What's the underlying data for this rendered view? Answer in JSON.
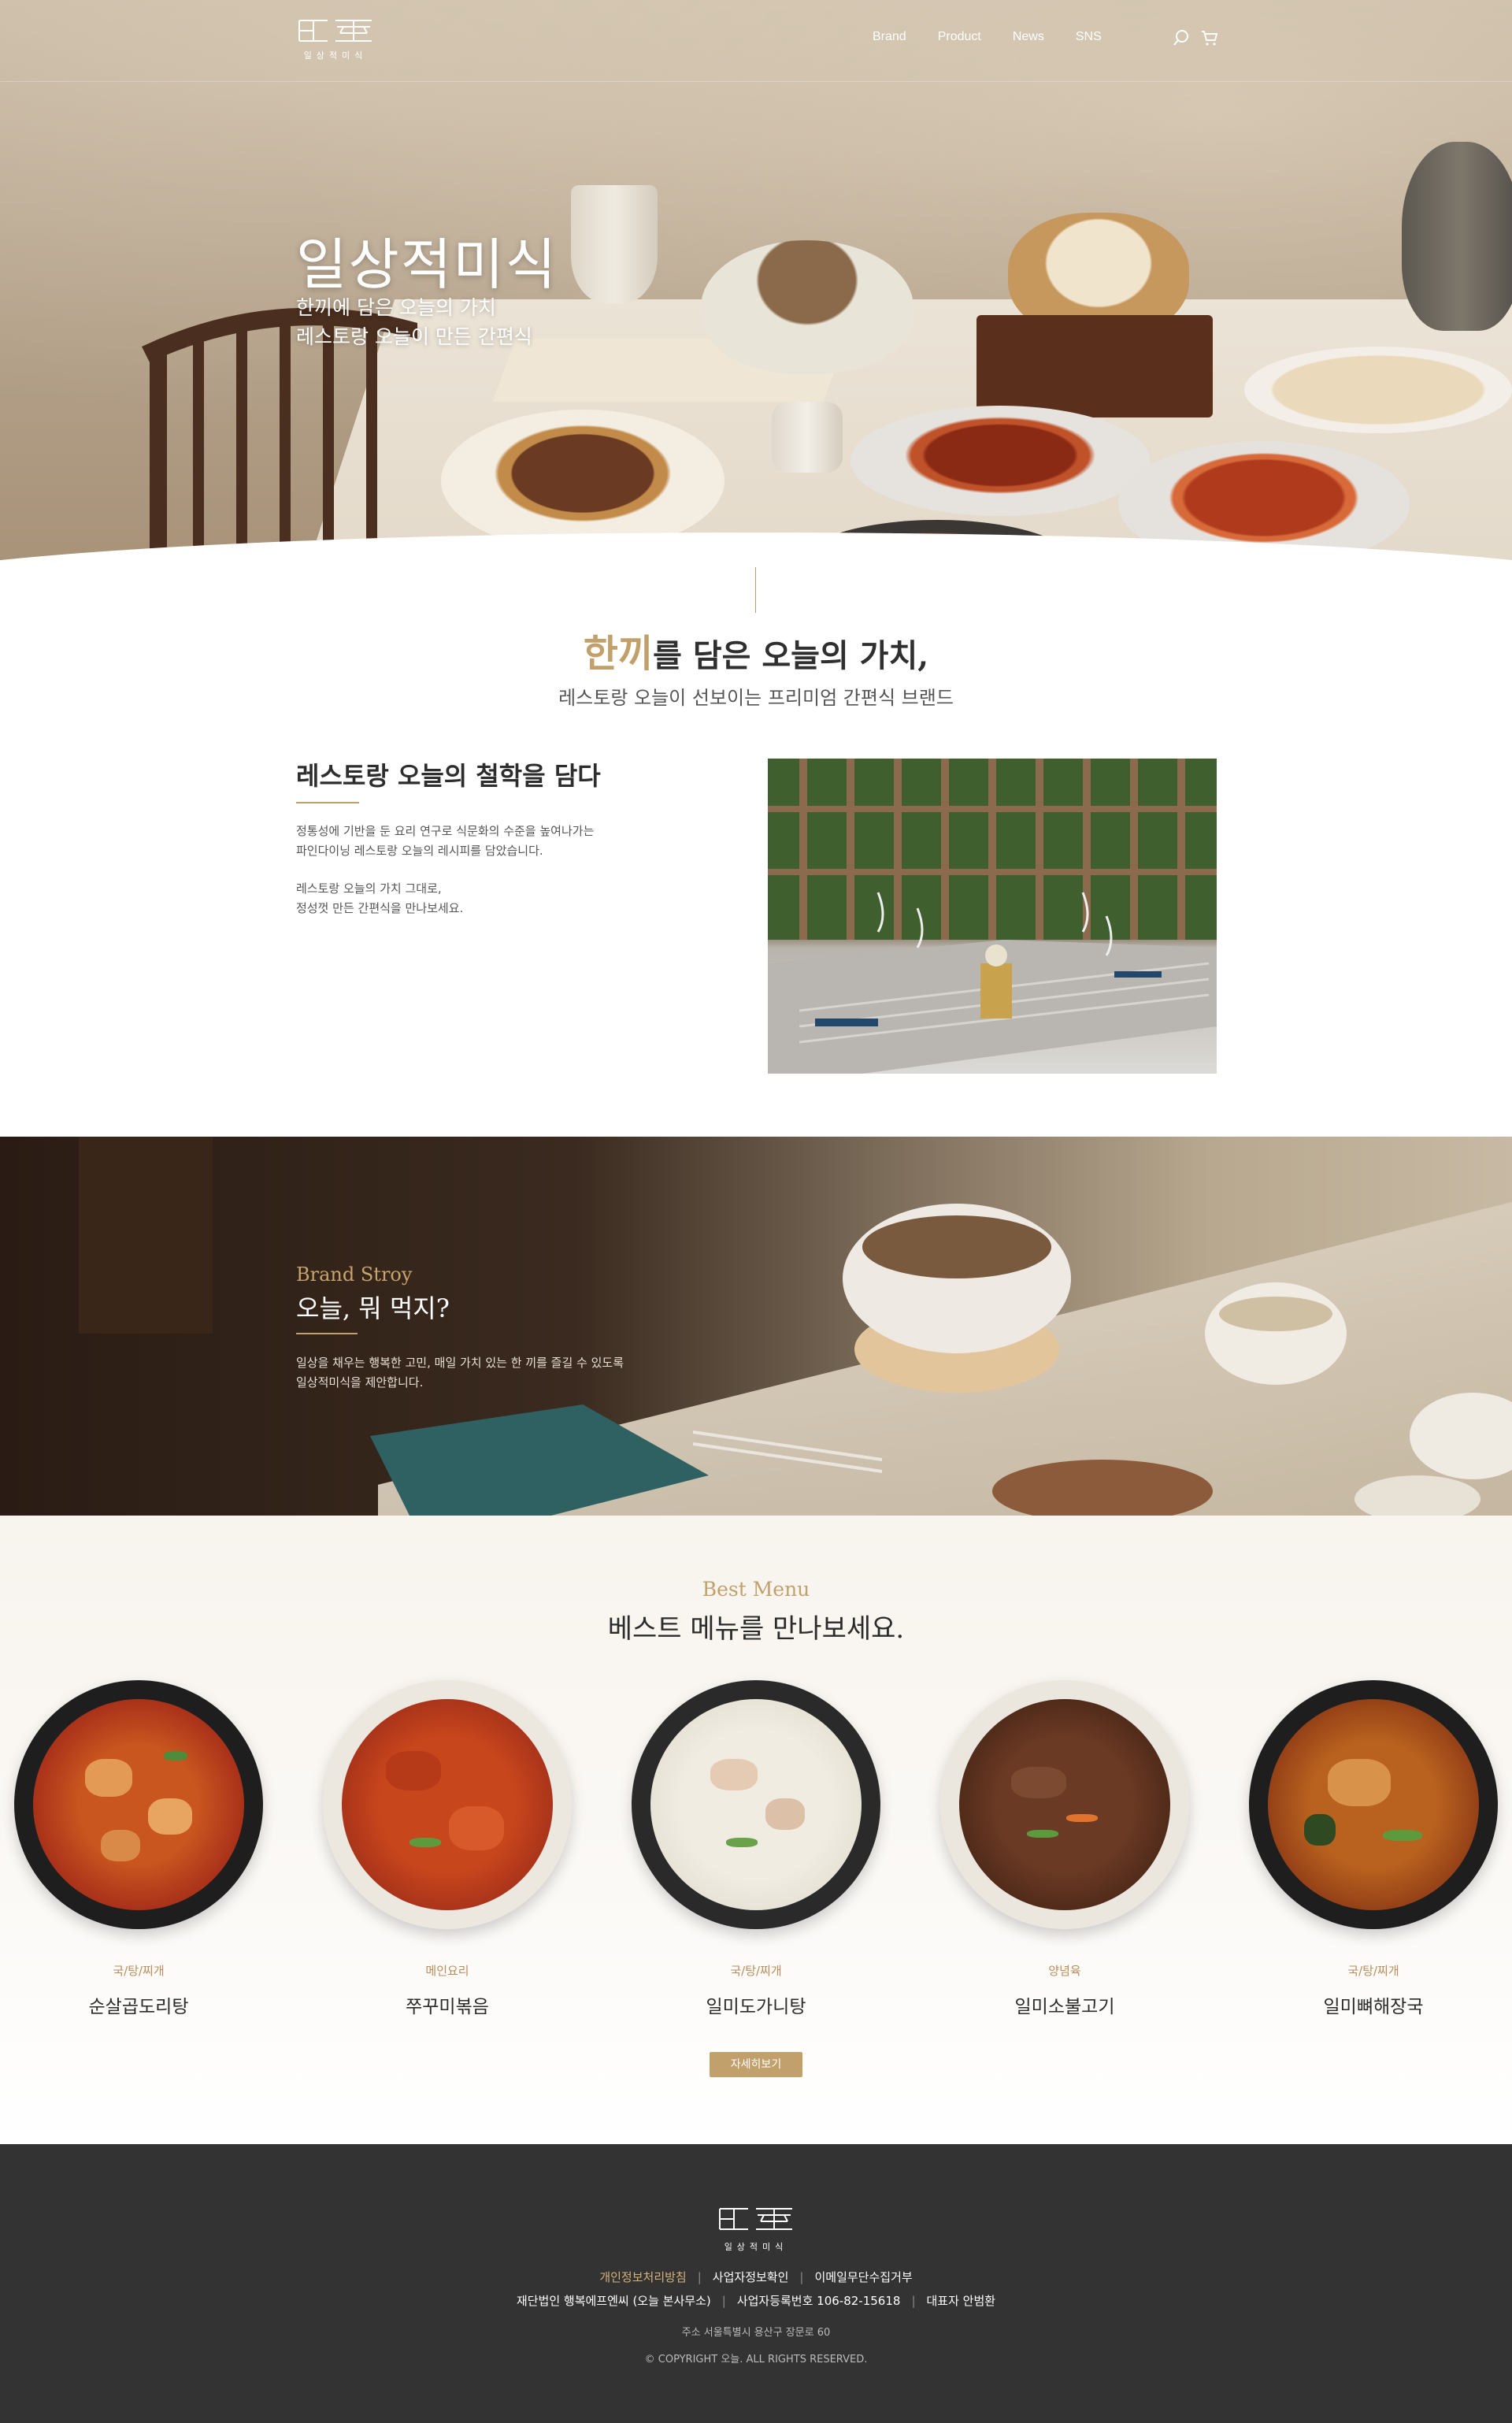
{
  "header": {
    "logo_sub": "일상적미식",
    "nav": [
      "Brand",
      "Product",
      "News",
      "SNS"
    ],
    "icons": [
      "search-icon",
      "cart-icon"
    ]
  },
  "hero": {
    "title": "일상적미식",
    "sub_line1": "한끼에 담은 오늘의 가치",
    "sub_line2": "레스토랑 오늘이 만든 간편식"
  },
  "intro": {
    "heading_accent": "한끼",
    "heading_rest": "를 담은 오늘의 가치,",
    "subheading": "레스토랑 오늘이 선보이는 프리미엄 간편식 브랜드",
    "phil_title": "레스토랑 오늘의 철학을 담다",
    "p1_line1": "정통성에 기반을 둔 요리 연구로 식문화의 수준을 높여나가는",
    "p1_line2": "파인다이닝 레스토랑 오늘의 레시피를 담았습니다.",
    "p2_line1": "레스토랑 오늘의 가치 그대로,",
    "p2_line2": "정성껏 만든 간편식을 만나보세요."
  },
  "story": {
    "label": "Brand Stroy",
    "title": "오늘, 뭐 먹지?",
    "body_line1": "일상을 채우는 행복한 고민, 매일 가치 있는 한 끼를 즐길 수 있도록",
    "body_line2": "일상적미식을 제안합니다."
  },
  "best": {
    "label": "Best Menu",
    "title": "베스트 메뉴를 만나보세요.",
    "items": [
      {
        "category": "국/탕/찌개",
        "name": "순살곱도리탕"
      },
      {
        "category": "메인요리",
        "name": "쭈꾸미볶음"
      },
      {
        "category": "국/탕/찌개",
        "name": "일미도가니탕"
      },
      {
        "category": "양념육",
        "name": "일미소불고기"
      },
      {
        "category": "국/탕/찌개",
        "name": "일미뼈해장국"
      }
    ],
    "more_button": "자세히보기"
  },
  "footer": {
    "logo_sub": "일상적미식",
    "links": [
      "개인정보처리방침",
      "사업자정보확인",
      "이메일무단수집거부"
    ],
    "company": "재단법인 행복에프엔씨 (오늘 본사무소)",
    "biz_no": "사업자등록번호 106-82-15618",
    "ceo": "대표자 안범환",
    "address": "주소 서울특별시 용산구 장문로 60",
    "copyright": "© COPYRIGHT 오늘. ALL RIGHTS RESERVED."
  },
  "colors": {
    "accent_gold": "#c2a06b",
    "footer_bg": "#333333"
  }
}
